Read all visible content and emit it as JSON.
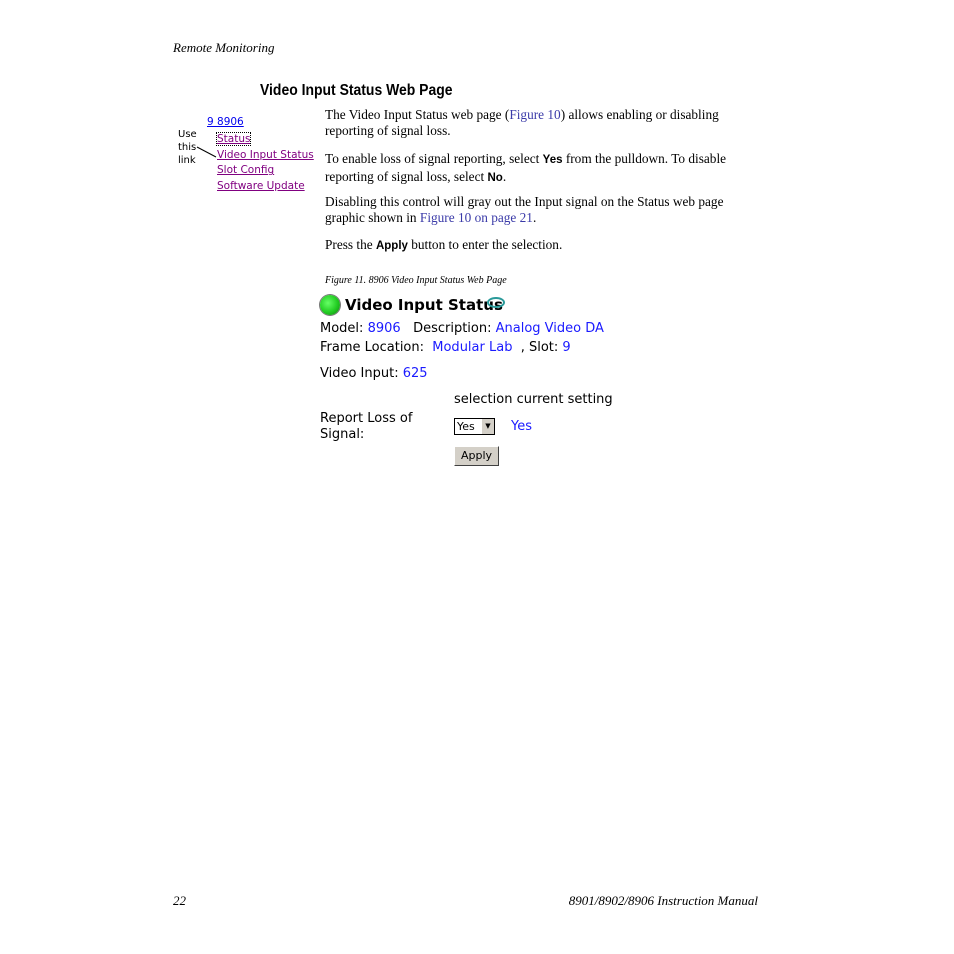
{
  "header": "Remote Monitoring",
  "section_title": "Video Input Status Web Page",
  "sidebar": {
    "note": [
      "Use",
      "this",
      "link"
    ],
    "slot": "9 8906",
    "links": [
      "Status",
      "Video Input Status",
      "Slot Config",
      "Software Update"
    ]
  },
  "paragraphs": {
    "p1a": "The Video Input Status web page (",
    "p1link": "Figure 10",
    "p1b": ") allows enabling or disabling reporting of signal loss.",
    "p2a": "To enable loss of signal reporting, select ",
    "p2yes": "Yes",
    "p2b": " from the pulldown. To disable reporting of signal loss, select ",
    "p2no": "No",
    "p2c": ".",
    "p3a": "Disabling this control will gray out the Input signal on the Status web page graphic shown in ",
    "p3link": "Figure 10 on page 21",
    "p3b": ".",
    "p4a": "Press the ",
    "p4apply": "Apply",
    "p4b": " button to enter the selection."
  },
  "caption": "Figure 11.  8906 Video Input Status Web Page",
  "figure": {
    "title": "Video Input Status",
    "model_label": "Model:",
    "model": "8906",
    "desc_label": "Description:",
    "desc": "Analog Video DA",
    "frame_label": "Frame Location:",
    "frame": "Modular Lab",
    "slot_label": ", Slot:",
    "slot": "9",
    "input_label": "Video Input:",
    "input": "625",
    "col_selection": "selection",
    "col_current": "current setting",
    "report_label": "Report Loss of Signal:",
    "select_value": "Yes",
    "current_value": "Yes",
    "apply": "Apply",
    "status_color": "#22cc22"
  },
  "footer": {
    "page": "22",
    "manual": "8901/8902/8906 Instruction Manual"
  }
}
